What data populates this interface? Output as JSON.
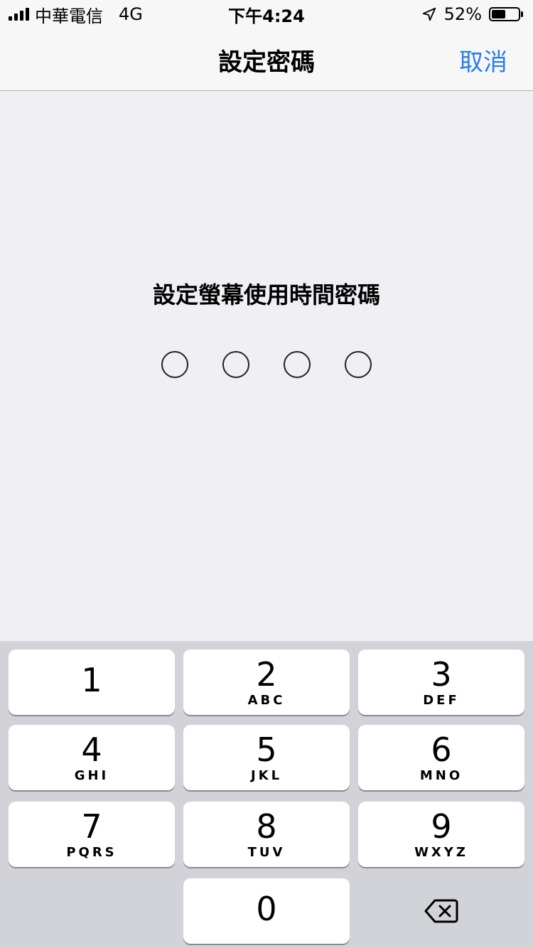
{
  "status": {
    "carrier": "中華電信",
    "network": "4G",
    "time": "下午4:24",
    "battery_percent": "52%",
    "battery_level": 0.52
  },
  "nav": {
    "title": "設定密碼",
    "cancel_label": "取消"
  },
  "main": {
    "prompt": "設定螢幕使用時間密碼",
    "digits_entered": 0,
    "digits_total": 4
  },
  "keypad": {
    "keys": [
      {
        "num": "1",
        "letters": ""
      },
      {
        "num": "2",
        "letters": "ABC"
      },
      {
        "num": "3",
        "letters": "DEF"
      },
      {
        "num": "4",
        "letters": "GHI"
      },
      {
        "num": "5",
        "letters": "JKL"
      },
      {
        "num": "6",
        "letters": "MNO"
      },
      {
        "num": "7",
        "letters": "PQRS"
      },
      {
        "num": "8",
        "letters": "TUV"
      },
      {
        "num": "9",
        "letters": "WXYZ"
      },
      {
        "num": "0",
        "letters": ""
      }
    ],
    "delete_icon": "backspace-icon"
  },
  "colors": {
    "accent": "#2b7de9",
    "background": "#efeff4",
    "keypad_bg": "#d1d3d9"
  }
}
